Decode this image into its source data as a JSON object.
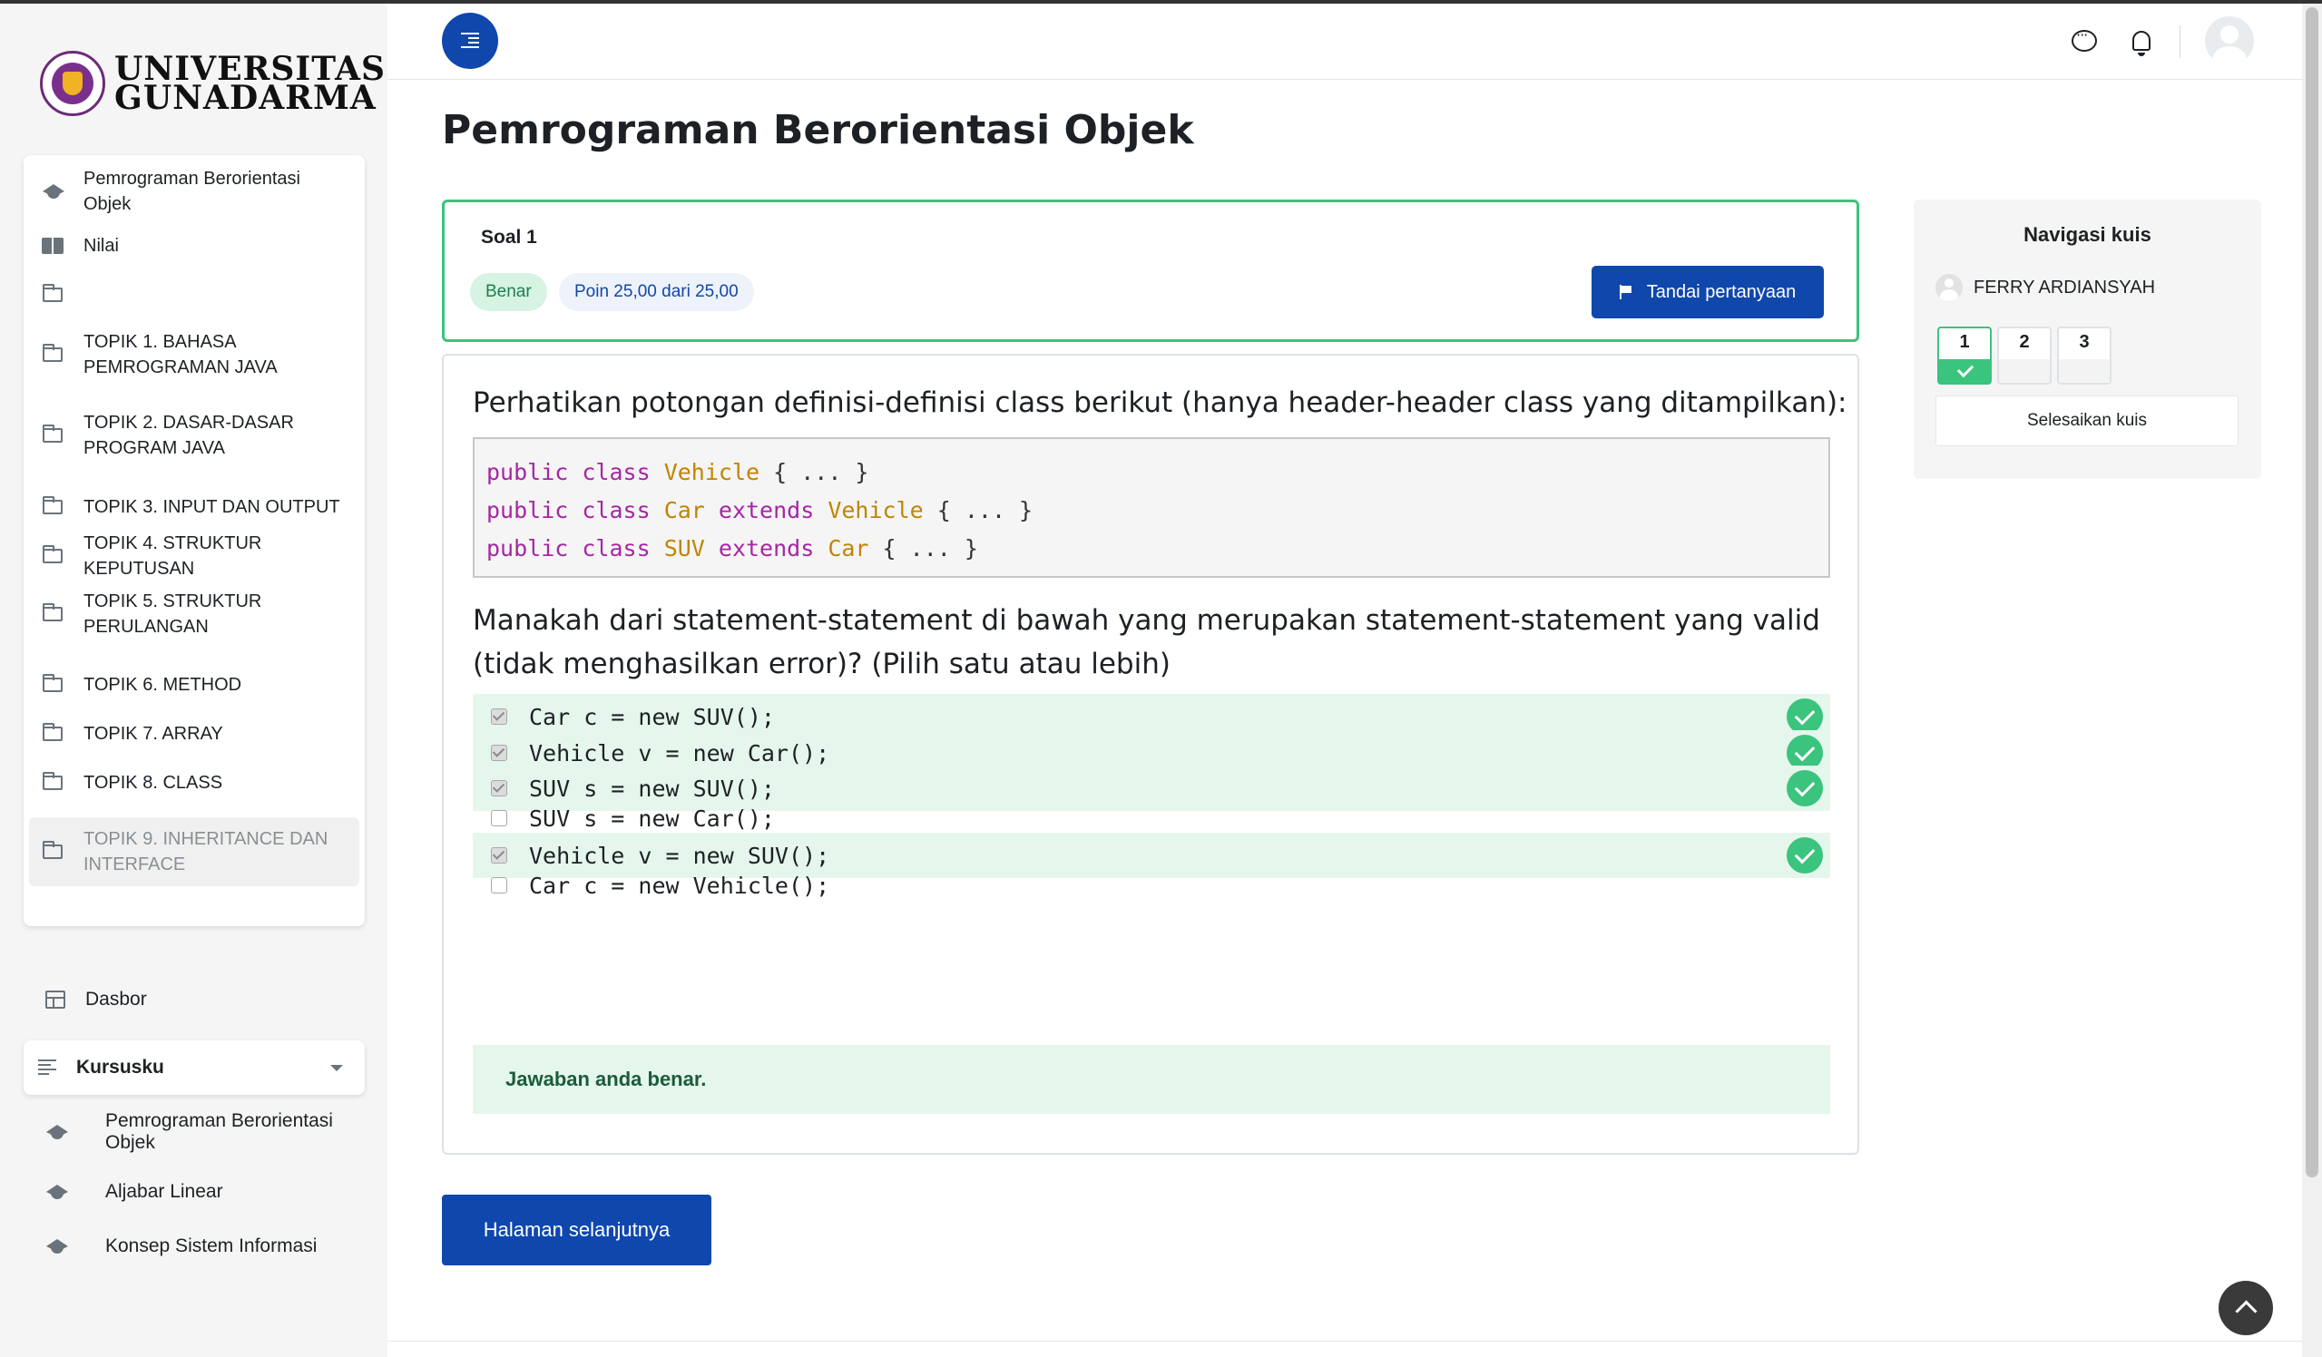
{
  "brand": {
    "line1": "UNIVERSITAS",
    "line2": "GUNADARMA"
  },
  "course_nav": [
    {
      "label": "Pemrograman Berorientasi Objek",
      "icon": "graduation-cap-icon"
    },
    {
      "label": "Nilai",
      "icon": "book-icon"
    },
    {
      "label": "",
      "icon": "folder-icon"
    },
    {
      "label": "TOPIK 1. BAHASA PEMROGRAMAN JAVA",
      "icon": "folder-icon"
    },
    {
      "label": "TOPIK 2. DASAR-DASAR PROGRAM JAVA",
      "icon": "folder-icon"
    },
    {
      "label": "TOPIK 3. INPUT DAN OUTPUT",
      "icon": "folder-icon"
    },
    {
      "label": "TOPIK 4. STRUKTUR KEPUTUSAN",
      "icon": "folder-icon"
    },
    {
      "label": "TOPIK 5. STRUKTUR PERULANGAN",
      "icon": "folder-icon"
    },
    {
      "label": "TOPIK 6. METHOD",
      "icon": "folder-icon"
    },
    {
      "label": "TOPIK 7. ARRAY",
      "icon": "folder-icon"
    },
    {
      "label": "TOPIK 8. CLASS",
      "icon": "folder-icon"
    },
    {
      "label": "TOPIK 9. INHERITANCE DAN INTERFACE",
      "icon": "folder-icon",
      "active": true
    }
  ],
  "dashboard": {
    "label": "Dasbor"
  },
  "my_courses": {
    "label": "Kursusku",
    "items": [
      "Pemrograman Berorientasi Objek",
      "Aljabar Linear",
      "Konsep Sistem Informasi"
    ]
  },
  "header": {
    "icons": [
      "drawer-toggle-icon",
      "chat-icon",
      "bell-icon",
      "user-avatar"
    ]
  },
  "page": {
    "title": "Pemrograman Berorientasi Objek"
  },
  "question": {
    "number_label": "Soal 1",
    "status": "Benar",
    "points": "Poin 25,00 dari 25,00",
    "flag_label": "Tandai pertanyaan",
    "intro": "Perhatikan potongan definisi-definisi class berikut (hanya header-header class yang ditampilkan):",
    "code_lines": [
      {
        "kw": "public class",
        "name": "Vehicle",
        "ext": "",
        "parent": "",
        "body": "{ ... }"
      },
      {
        "kw": "public class",
        "name": "Car",
        "ext": "extends",
        "parent": "Vehicle",
        "body": "{ ... }"
      },
      {
        "kw": "public class",
        "name": "SUV",
        "ext": "extends",
        "parent": "Car",
        "body": "{ ... }"
      }
    ],
    "prompt": "Manakah dari statement-statement di bawah yang merupakan statement-statement yang valid (tidak menghasilkan error)? (Pilih satu atau lebih)",
    "answers": [
      {
        "text": "Car c = new SUV();",
        "checked": true,
        "correct": true
      },
      {
        "text": "Vehicle v = new Car();",
        "checked": true,
        "correct": true
      },
      {
        "text": "SUV s = new SUV();",
        "checked": true,
        "correct": true
      },
      {
        "text": "SUV s = new Car();",
        "checked": false,
        "correct": false
      },
      {
        "text": "Vehicle v = new SUV();",
        "checked": true,
        "correct": true
      },
      {
        "text": "Car c = new Vehicle();",
        "checked": false,
        "correct": false
      }
    ],
    "feedback": "Jawaban anda benar."
  },
  "next_button": "Halaman selanjutnya",
  "quiz_nav": {
    "title": "Navigasi kuis",
    "user": "FERRY ARDIANSYAH",
    "questions": [
      "1",
      "2",
      "3"
    ],
    "finish_label": "Selesaikan kuis"
  },
  "colors": {
    "primary": "#0f47ad",
    "success": "#3ac47d",
    "success_bg": "#e5f6ed"
  }
}
